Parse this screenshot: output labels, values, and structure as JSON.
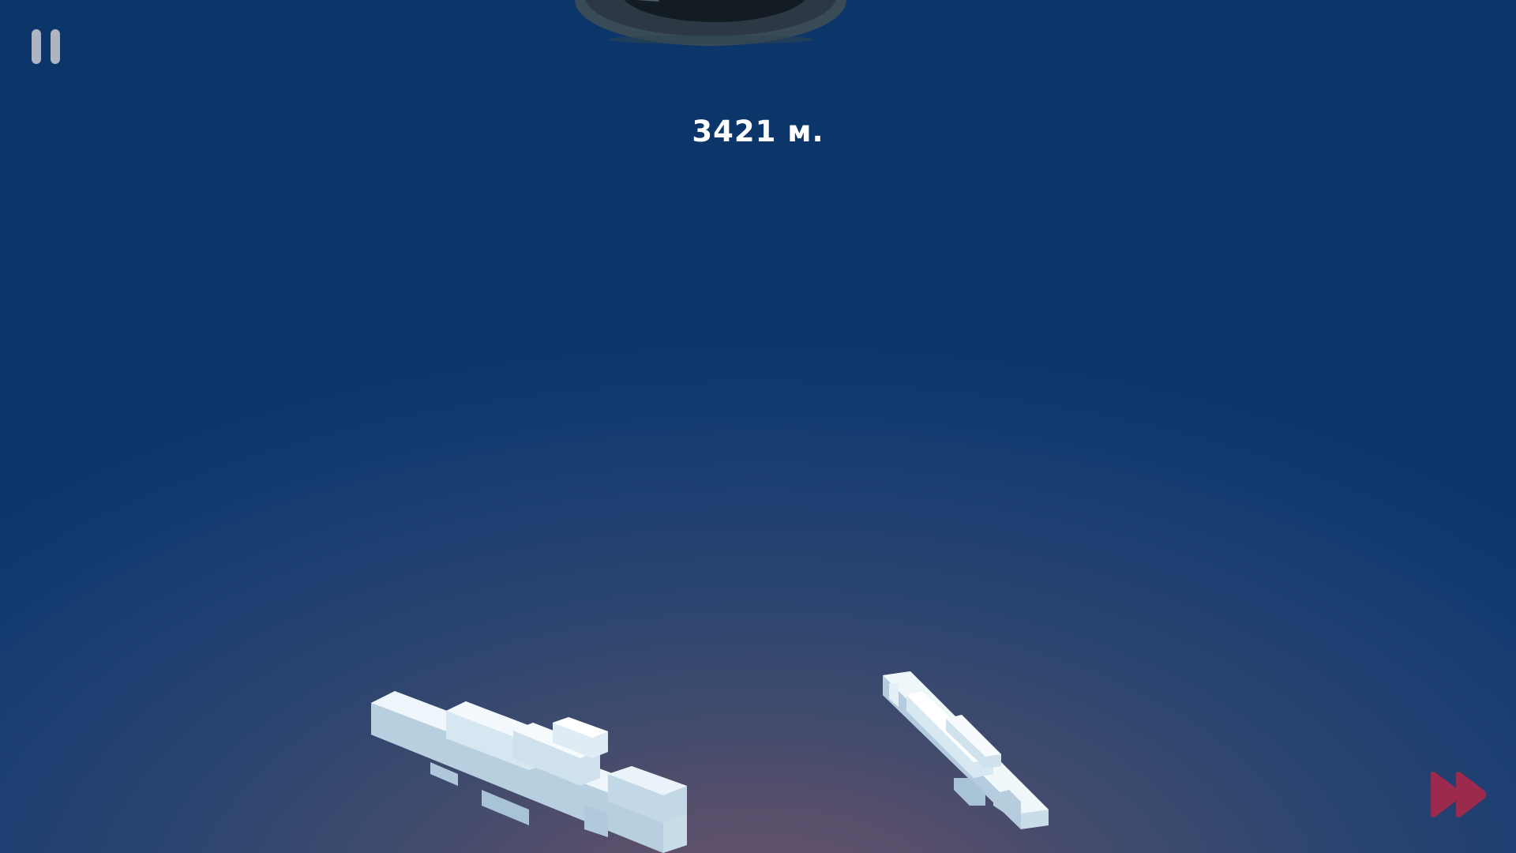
{
  "hud": {
    "distance": "3421 м."
  },
  "controls": {
    "pause_icon": "pause-icon",
    "fast_forward_icon": "fast-forward-icon"
  },
  "colors": {
    "sky_top": "#0c356a",
    "sky_bottom": "#6a5371",
    "ship": "#dce9f3",
    "fast_forward": "#9b2a4c",
    "pause": "#aeb4c2"
  }
}
